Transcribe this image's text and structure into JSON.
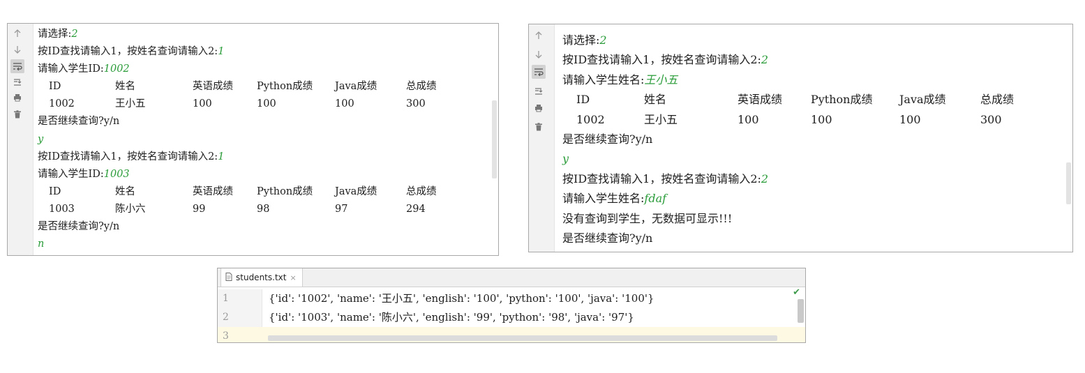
{
  "left_console": {
    "lines": [
      {
        "prompt": "请选择:",
        "input": "2"
      },
      {
        "prompt": "按ID查找请输入1，按姓名查询请输入2:",
        "input": "1"
      },
      {
        "prompt": "请输入学生ID:",
        "input": "1002"
      },
      {
        "row": [
          "ID",
          "姓名",
          "英语成绩",
          "Python成绩",
          "Java成绩",
          "总成绩"
        ]
      },
      {
        "row": [
          "1002",
          "王小五",
          "100",
          "100",
          "100",
          "300"
        ]
      },
      {
        "prompt": "是否继续查询?y/n",
        "input": ""
      },
      {
        "prompt": "",
        "input": "y"
      },
      {
        "prompt": "按ID查找请输入1，按姓名查询请输入2:",
        "input": "1"
      },
      {
        "prompt": "请输入学生ID:",
        "input": "1003"
      },
      {
        "row": [
          "ID",
          "姓名",
          "英语成绩",
          "Python成绩",
          "Java成绩",
          "总成绩"
        ]
      },
      {
        "row": [
          "1003",
          "陈小六",
          "99",
          "98",
          "97",
          "294"
        ]
      },
      {
        "prompt": "是否继续查询?y/n",
        "input": ""
      },
      {
        "prompt": "",
        "input": "n"
      }
    ]
  },
  "right_console": {
    "lines": [
      {
        "prompt": "请选择:",
        "input": "2"
      },
      {
        "prompt": "按ID查找请输入1，按姓名查询请输入2:",
        "input": "2"
      },
      {
        "prompt": "请输入学生姓名:",
        "input": "王小五"
      },
      {
        "row": [
          "ID",
          "姓名",
          "英语成绩",
          "Python成绩",
          "Java成绩",
          "总成绩"
        ]
      },
      {
        "row": [
          "1002",
          "王小五",
          "100",
          "100",
          "100",
          "300"
        ]
      },
      {
        "prompt": "是否继续查询?y/n",
        "input": ""
      },
      {
        "prompt": "",
        "input": "y"
      },
      {
        "prompt": "按ID查找请输入1，按姓名查询请输入2:",
        "input": "2"
      },
      {
        "prompt": "请输入学生姓名:",
        "input": "fdaf"
      },
      {
        "prompt": "没有查询到学生，无数据可显示!!!",
        "input": ""
      },
      {
        "prompt": "是否继续查询?y/n",
        "input": ""
      }
    ]
  },
  "console_tools": [
    "up-arrow-icon",
    "down-arrow-icon",
    "soft-wrap-icon",
    "scroll-to-end-icon",
    "print-icon",
    "trash-icon"
  ],
  "editor": {
    "tab_label": "students.txt",
    "close_glyph": "×",
    "status_glyph": "✔",
    "lines": [
      {
        "num": "1",
        "text": "{'id': '1002', 'name': '王小五', 'english': '100', 'python': '100', 'java': '100'}"
      },
      {
        "num": "2",
        "text": "{'id': '1003', 'name': '陈小六', 'english': '99', 'python': '98', 'java': '97'}"
      },
      {
        "num": "3",
        "text": ""
      }
    ]
  },
  "colors": {
    "input_text": "#2a9c39",
    "current_line": "#fdf9e2",
    "check": "#3c9a4a"
  }
}
